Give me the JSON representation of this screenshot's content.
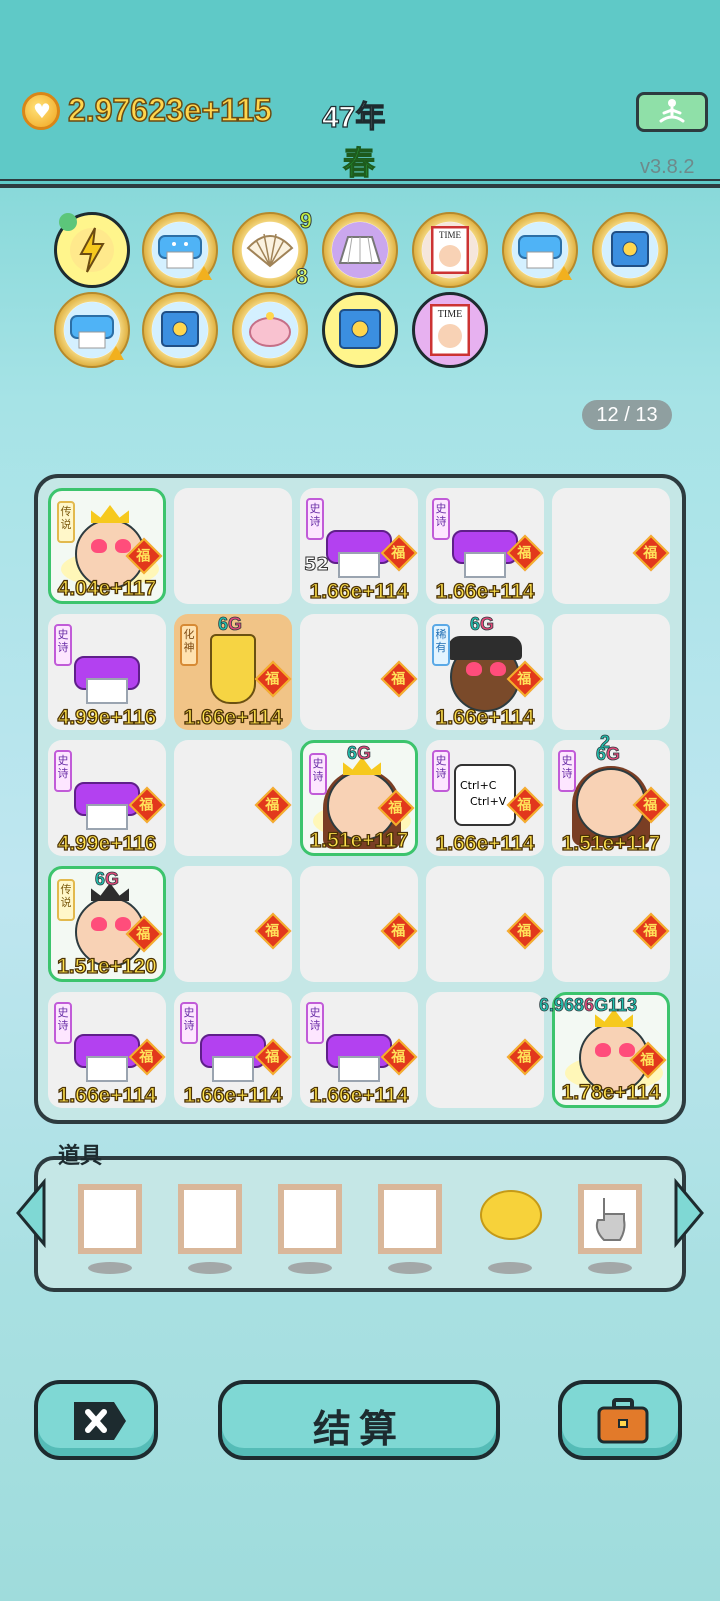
{
  "header": {
    "money": "2.97623e+115",
    "year": "47年",
    "season": "春",
    "version": "v3.8.2"
  },
  "inventory": {
    "items": [
      {
        "icon": "lightning-icon",
        "badge_top": "",
        "badge_bottom": ""
      },
      {
        "icon": "printer-icon",
        "badge_top": "",
        "badge_bottom": ""
      },
      {
        "icon": "shell-icon",
        "badge_top": "9",
        "badge_bottom": "8"
      },
      {
        "icon": "skirt-icon",
        "badge_top": "",
        "badge_bottom": ""
      },
      {
        "icon": "time-magazine-icon",
        "badge_top": "",
        "badge_bottom": ""
      },
      {
        "icon": "printer-icon",
        "badge_top": "",
        "badge_bottom": ""
      },
      {
        "icon": "safe-icon",
        "badge_top": "",
        "badge_bottom": ""
      },
      {
        "icon": "printer-icon",
        "badge_top": "",
        "badge_bottom": ""
      },
      {
        "icon": "safe-icon",
        "badge_top": "",
        "badge_bottom": ""
      },
      {
        "icon": "piggy-bank-icon",
        "badge_top": "",
        "badge_bottom": ""
      },
      {
        "icon": "safe-icon",
        "badge_top": "",
        "badge_bottom": ""
      },
      {
        "icon": "time-magazine-icon",
        "badge_top": "",
        "badge_bottom": ""
      }
    ],
    "counter": "12 / 13"
  },
  "board": {
    "fu": "福",
    "tags": {
      "epic": "史诗",
      "legend": "传说",
      "rare": "稀有",
      "god": "化神"
    },
    "cells": [
      [
        "4.04e+117",
        "",
        "1.66e+114",
        "1.66e+114",
        ""
      ],
      [
        "4.99e+116",
        "1.66e+114",
        "",
        "1.66e+114",
        ""
      ],
      [
        "4.99e+116",
        "",
        "1.51e+117",
        "1.66e+114",
        "1.51e+117"
      ],
      [
        "1.51e+120",
        "",
        "",
        "",
        ""
      ],
      [
        "1.66e+114",
        "1.66e+114",
        "1.66e+114",
        "",
        "1.78e+114"
      ]
    ],
    "g6": "6",
    "g": "G",
    "num52": "52",
    "num2": "2",
    "top_right": "6.968",
    "top_right2": "113",
    "copy_line1": "Ctrl+C",
    "copy_line2": "Ctrl+V"
  },
  "props": {
    "title": "道具"
  },
  "buttons": {
    "settle": "结算"
  }
}
